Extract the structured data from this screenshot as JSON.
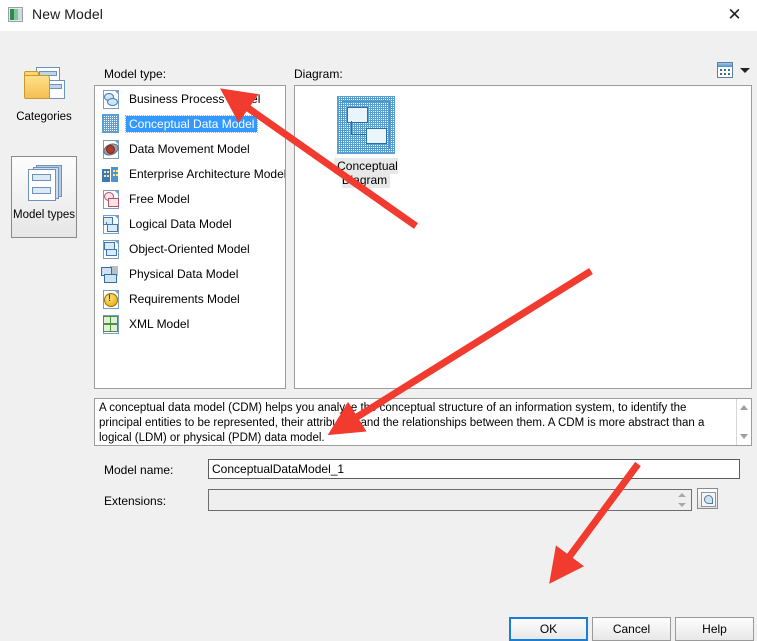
{
  "window": {
    "title": "New Model",
    "icon": "app-window-icon",
    "close_label": "✕"
  },
  "left_rail": {
    "items": [
      {
        "label": "Categories",
        "icon": "folder-documents-icon",
        "selected": false
      },
      {
        "label": "Model types",
        "icon": "document-stack-icon",
        "selected": true
      }
    ]
  },
  "model_type": {
    "label": "Model type:",
    "items": [
      {
        "label": "Business Process Model",
        "icon": "business-process-model-icon",
        "selected": false
      },
      {
        "label": "Conceptual Data Model",
        "icon": "conceptual-data-model-icon",
        "selected": true
      },
      {
        "label": "Data Movement Model",
        "icon": "data-movement-model-icon",
        "selected": false
      },
      {
        "label": "Enterprise Architecture Model",
        "icon": "enterprise-architecture-model-icon",
        "selected": false
      },
      {
        "label": "Free Model",
        "icon": "free-model-icon",
        "selected": false
      },
      {
        "label": "Logical Data Model",
        "icon": "logical-data-model-icon",
        "selected": false
      },
      {
        "label": "Object-Oriented Model",
        "icon": "object-oriented-model-icon",
        "selected": false
      },
      {
        "label": "Physical Data Model",
        "icon": "physical-data-model-icon",
        "selected": false
      },
      {
        "label": "Requirements Model",
        "icon": "requirements-model-icon",
        "selected": false
      },
      {
        "label": "XML Model",
        "icon": "xml-model-icon",
        "selected": false
      }
    ]
  },
  "diagram": {
    "label": "Diagram:",
    "view_mode_icon": "grid-view-icon",
    "view_mode_dropdown_icon": "chevron-down-icon",
    "items": [
      {
        "label": "Conceptual Diagram",
        "icon": "conceptual-diagram-icon",
        "selected": true
      }
    ]
  },
  "description": {
    "text": "A conceptual data model (CDM) helps you analyze the conceptual structure of an information system, to identify the principal entities to be represented, their attributes, and the relationships between them. A CDM is more abstract than a logical (LDM) or physical (PDM) data model."
  },
  "form": {
    "model_name": {
      "label": "Model name:",
      "value": "ConceptualDataModel_1",
      "placeholder": ""
    },
    "extensions": {
      "label": "Extensions:",
      "value": "",
      "placeholder": "",
      "browse_icon": "browse-extensions-icon"
    }
  },
  "footer": {
    "ok_label": "OK",
    "cancel_label": "Cancel",
    "help_label": "Help"
  },
  "annotations": {
    "arrow_color": "#f23b2f",
    "count": 3
  },
  "colors": {
    "selection_blue": "#3399ff",
    "focus_border": "#1a7fd4",
    "dialog_bg": "#f0f0f0",
    "field_bg": "#ffffff"
  }
}
